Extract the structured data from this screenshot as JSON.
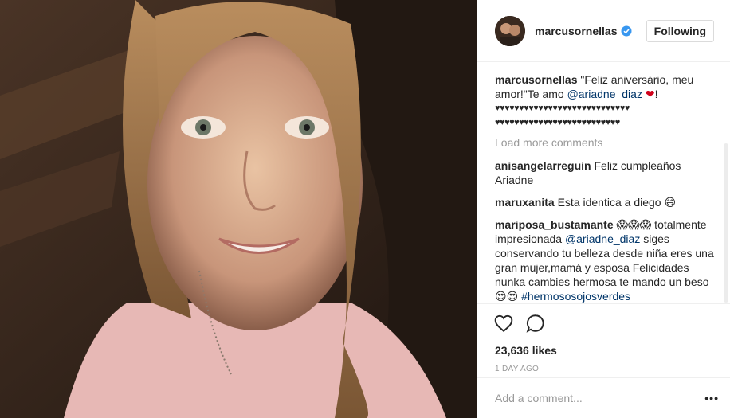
{
  "post": {
    "username": "marcusornellas",
    "follow_label": "Following",
    "caption_text": " \"Feliz aniversário, meu amor!\"Te amo ",
    "caption_mention": "@ariadne_diaz",
    "caption_heart": "❤",
    "caption_end": "!",
    "hearts_line1": "♥♥♥♥♥♥♥♥♥♥♥♥♥♥♥♥♥♥♥♥♥♥♥♥♥♥♥♥",
    "hearts_line2": "♥♥♥♥♥♥♥♥♥♥♥♥♥♥♥♥♥♥♥♥♥♥♥♥♥♥",
    "load_more": "Load more comments",
    "likes": "23,636 likes",
    "time_ago": "1 DAY AGO",
    "add_comment_placeholder": "Add a comment...",
    "more_options": "•••"
  },
  "comments": [
    {
      "user": "anisangelarreguin",
      "text": " Feliz cumpleaños Ariadne"
    },
    {
      "user": "maruxanita",
      "text": " Esta identica a diego 😄"
    },
    {
      "user": "mariposa_bustamante",
      "text_a": " 😱😱😱 totalmente impresionada ",
      "mention": "@ariadne_diaz",
      "text_b": " siges conservando tu belleza desde niña eres una gran mujer,mamá y esposa Felicidades nunka cambies hermosa te mando un beso 😍😍 ",
      "hashtag": "#hermososojosverdes"
    }
  ],
  "icons": {
    "verified": "verified-badge-icon",
    "like": "heart-icon",
    "comment": "comment-icon"
  },
  "colors": {
    "verified": "#3897f0",
    "link": "#003569",
    "muted": "#999999"
  }
}
